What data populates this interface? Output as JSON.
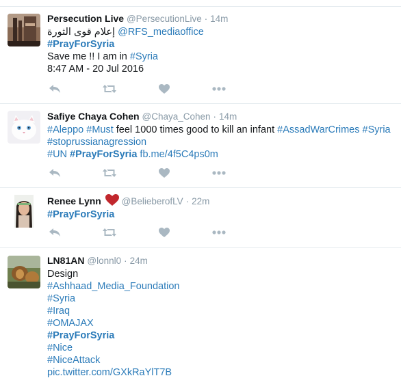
{
  "tweets": [
    {
      "name": "Persecution Live",
      "handle": "@PersecutionLive",
      "time": "14m",
      "lines": [
        [
          {
            "text": "إعلام قوى الثورة ",
            "type": "text"
          },
          {
            "text": "@RFS_mediaoffice",
            "type": "tag"
          }
        ],
        [
          {
            "text": "#PrayForSyria",
            "type": "tag-bold"
          }
        ],
        [
          {
            "text": "Save me !! I am in ",
            "type": "text"
          },
          {
            "text": "#Syria",
            "type": "tag"
          }
        ],
        [
          {
            "text": "8:47 AM - 20 Jul 2016",
            "type": "text"
          }
        ]
      ]
    },
    {
      "name": "Safiye Chaya Cohen",
      "handle": "@Chaya_Cohen",
      "time": "14m",
      "lines": [
        [
          {
            "text": "#Aleppo",
            "type": "tag"
          },
          {
            "text": " ",
            "type": "text"
          },
          {
            "text": "#Must",
            "type": "tag"
          },
          {
            "text": " feel 1000 times good to kill an infant ",
            "type": "text"
          },
          {
            "text": "#AssadWarCrimes",
            "type": "tag"
          },
          {
            "text": " ",
            "type": "text"
          },
          {
            "text": "#Syria",
            "type": "tag"
          }
        ],
        [
          {
            "text": "#stoprussianagression",
            "type": "tag"
          }
        ],
        [
          {
            "text": "#UN",
            "type": "tag"
          },
          {
            "text": " ",
            "type": "text"
          },
          {
            "text": "#PrayForSyria",
            "type": "tag-bold"
          },
          {
            "text": " ",
            "type": "text"
          },
          {
            "text": "fb.me/4f5C4ps0m",
            "type": "tag"
          }
        ]
      ]
    },
    {
      "name": "Renee Lynn",
      "handle": "@BelieberofLV",
      "time": "22m",
      "lines": [
        [
          {
            "text": "#PrayForSyria",
            "type": "tag-bold"
          }
        ]
      ]
    },
    {
      "name": "LN81AN",
      "handle": "@lonnl0",
      "time": "24m",
      "lines": [
        [
          {
            "text": "Design",
            "type": "text"
          }
        ],
        [
          {
            "text": "#Ashhaad_Media_Foundation",
            "type": "tag"
          }
        ],
        [
          {
            "text": "#Syria",
            "type": "tag"
          }
        ],
        [
          {
            "text": "#Iraq",
            "type": "tag"
          }
        ],
        [
          {
            "text": "#OMAJAX",
            "type": "tag"
          }
        ],
        [
          {
            "text": "#PrayForSyria",
            "type": "tag-bold"
          }
        ],
        [
          {
            "text": "#Nice",
            "type": "tag"
          }
        ],
        [
          {
            "text": "#NiceAttack",
            "type": "tag"
          }
        ],
        [
          {
            "text": "pic.twitter.com/GXkRaYlT7B",
            "type": "tag"
          }
        ]
      ]
    }
  ],
  "separator": "·",
  "icons": {
    "reply": "reply-icon",
    "retweet": "retweet-icon",
    "like": "heart-icon",
    "more": "more-icon"
  },
  "colors": {
    "link": "#2b7bb9",
    "muted": "#8899a6",
    "action_icon": "#aab8c2",
    "heart_emoji": "#c1272d"
  }
}
